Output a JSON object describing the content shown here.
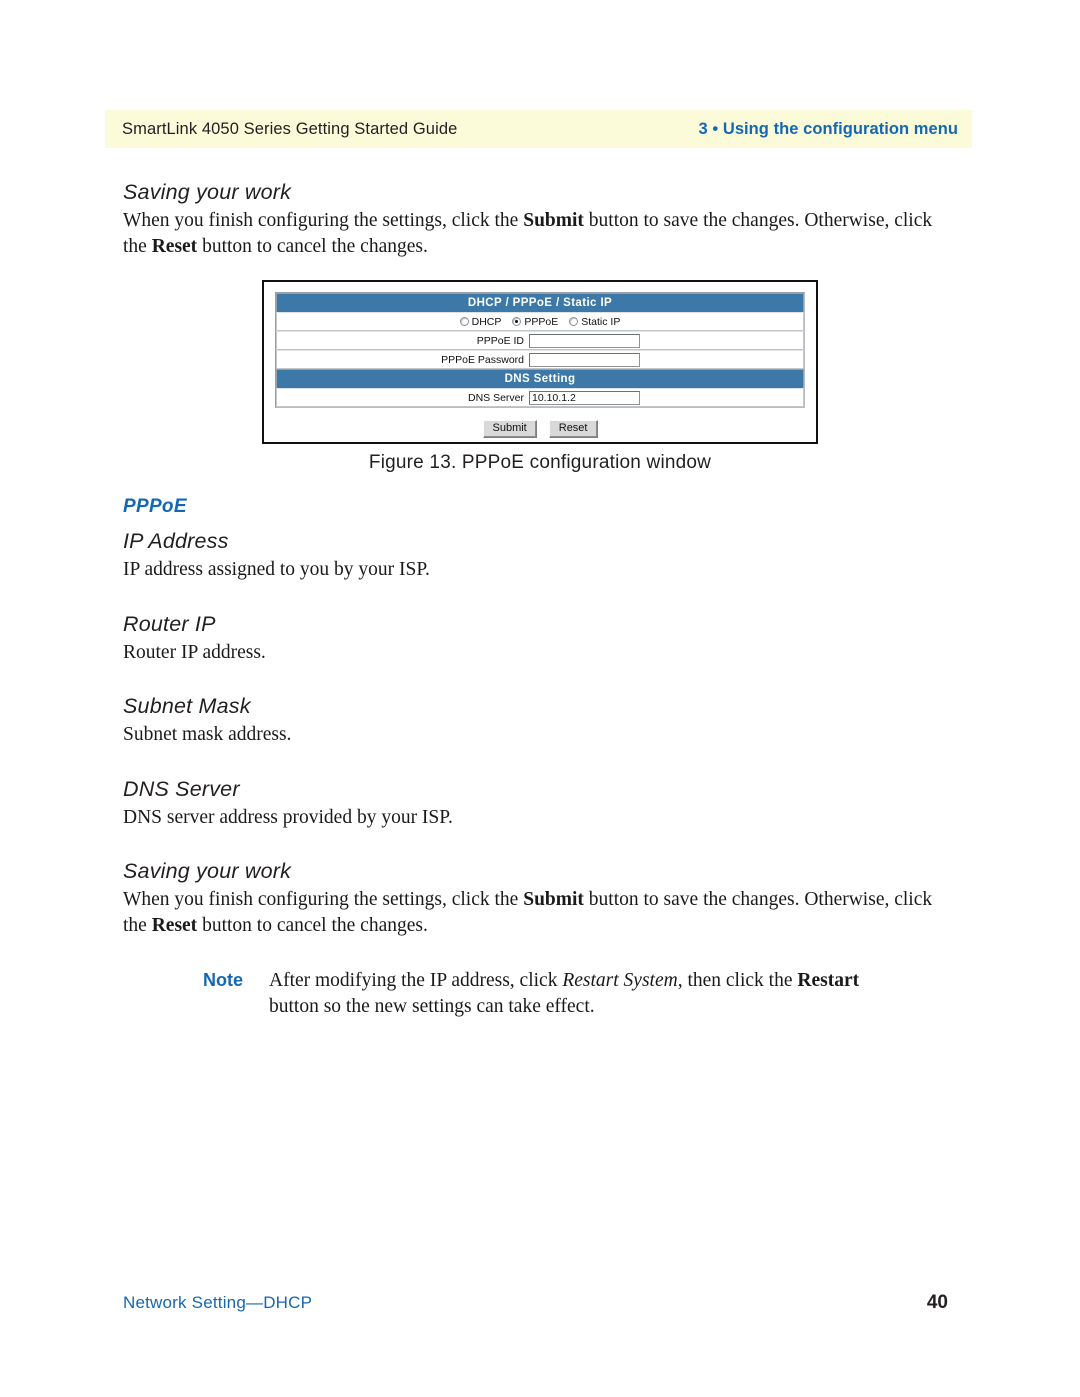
{
  "header": {
    "left_title": "SmartLink 4050 Series Getting Started Guide",
    "right_title": "3 • Using the configuration menu",
    "band_color": "#fbfbda",
    "accent_color": "#1468b3"
  },
  "sections": {
    "saving_top": {
      "heading": "Saving your work",
      "body_prefix": "When you finish configuring the settings, click the ",
      "body_bold1": "Submit",
      "body_mid": " button to save the changes. Otherwise, click the ",
      "body_bold2": "Reset",
      "body_suffix": " button to cancel the changes."
    },
    "pppoe_heading": "PPPoE",
    "ip_address": {
      "heading": "IP Address",
      "body": "IP address assigned to you by your ISP."
    },
    "router_ip": {
      "heading": "Router IP",
      "body": "Router IP address."
    },
    "subnet_mask": {
      "heading": "Subnet Mask",
      "body": "Subnet mask address."
    },
    "dns_server": {
      "heading": "DNS Server",
      "body": "DNS server address provided by your ISP."
    },
    "saving_bottom": {
      "heading": "Saving your work",
      "body_prefix": "When you finish configuring the settings, click the ",
      "body_bold1": "Submit",
      "body_mid": " button to save the changes. Otherwise, click the ",
      "body_bold2": "Reset",
      "body_suffix": " button to cancel the changes."
    },
    "note": {
      "label": "Note",
      "text_prefix": "After modifying the IP address, click ",
      "text_italic": "Restart System",
      "text_mid": ", then click the ",
      "text_bold": "Restart",
      "text_suffix": " button so the new settings can take effect."
    }
  },
  "figure": {
    "caption": "Figure 13. PPPoE configuration window",
    "window": {
      "title_bar": "DHCP / PPPoE / Static IP",
      "dns_bar": "DNS  Setting",
      "radios": [
        {
          "label": "DHCP",
          "selected": false
        },
        {
          "label": "PPPoE",
          "selected": true
        },
        {
          "label": "Static IP",
          "selected": false
        }
      ],
      "fields": [
        {
          "label": "PPPoE ID",
          "value": ""
        },
        {
          "label": "PPPoE Password",
          "value": ""
        }
      ],
      "dns_field": {
        "label": "DNS Server",
        "value": "10.10.1.2"
      },
      "buttons": [
        {
          "label": "Submit"
        },
        {
          "label": "Reset"
        }
      ],
      "bar_color": "#3c78a8"
    }
  },
  "footer": {
    "left": "Network Setting—DHCP",
    "page_number": "40"
  }
}
